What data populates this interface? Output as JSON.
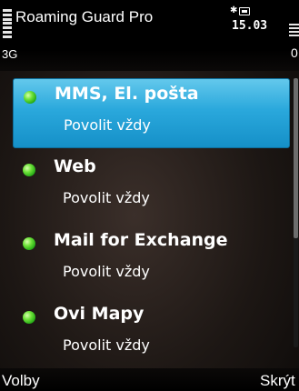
{
  "status_bar": {
    "app_title": "Roaming Guard Pro",
    "network": "3G",
    "clock": "15.03",
    "bluetooth_icon": "bluetooth-icon",
    "battery_icon": "battery-icon",
    "right_edge_text": "0"
  },
  "list": {
    "items": [
      {
        "title": "MMS, El. pošta",
        "subtitle": "Povolit vždy",
        "status": "enabled",
        "selected": true
      },
      {
        "title": "Web",
        "subtitle": "Povolit vždy",
        "status": "enabled",
        "selected": false
      },
      {
        "title": "Mail for Exchange",
        "subtitle": "Povolit vždy",
        "status": "enabled",
        "selected": false
      },
      {
        "title": "Ovi Mapy",
        "subtitle": "Povolit vždy",
        "status": "enabled",
        "selected": false
      }
    ]
  },
  "softkeys": {
    "left": "Volby",
    "right": "Skrýt"
  },
  "colors": {
    "selection": "#2aa8dc",
    "status_dot": "#4cd62a",
    "background": "#1d1714"
  }
}
